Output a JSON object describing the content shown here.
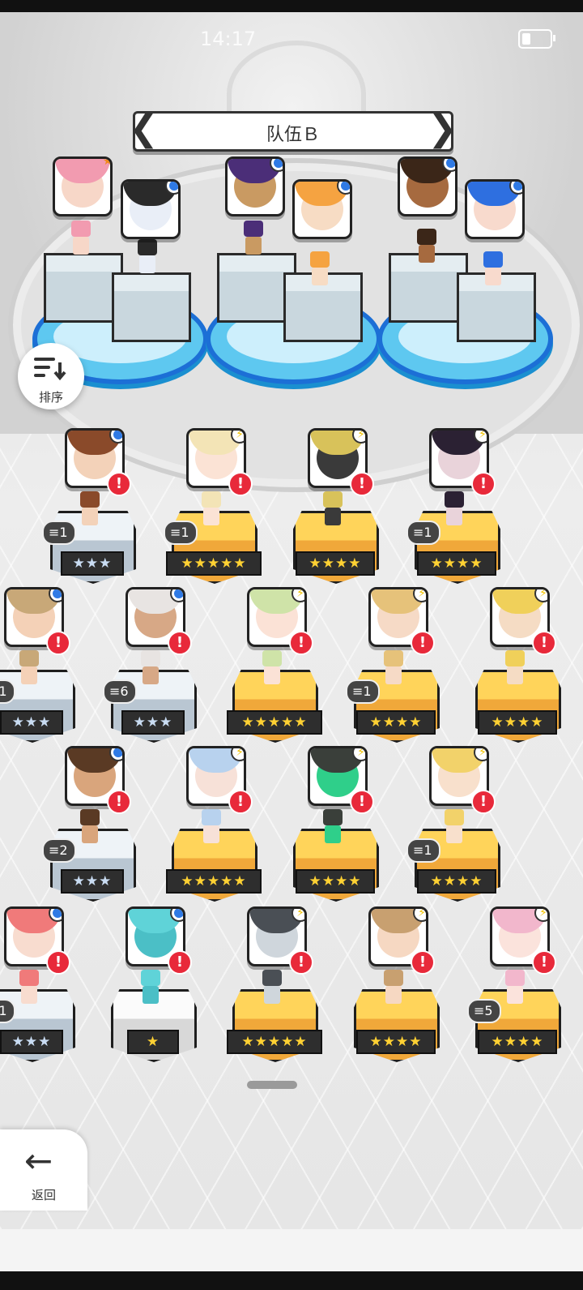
{
  "status": {
    "time": "14:17"
  },
  "team": {
    "title": "队伍Ｂ",
    "prev": "❮",
    "next": "❯"
  },
  "controls": {
    "sort_label": "排序",
    "back_label": "返回",
    "back_glyph": "←"
  },
  "team_members": [
    {
      "badge": "star",
      "badge_glyph": "★",
      "hair": "#f29bb0",
      "skin": "#f7d7c8"
    },
    {
      "badge": "blue",
      "badge_glyph": "",
      "hair": "#2a2a2a",
      "skin": "#e9eef7"
    },
    {
      "badge": "blue",
      "badge_glyph": "",
      "hair": "#4b2e78",
      "skin": "#c99a62"
    },
    {
      "badge": "blue",
      "badge_glyph": "",
      "hair": "#f5a341",
      "skin": "#f7dcc4"
    },
    {
      "badge": "blue",
      "badge_glyph": "",
      "hair": "#3b2618",
      "skin": "#a66a3f"
    },
    {
      "badge": "blue",
      "badge_glyph": "",
      "hair": "#2e6fe0",
      "skin": "#f8dacd"
    }
  ],
  "roster": [
    {
      "badge": "blue",
      "badge_glyph": "",
      "hair": "#8a4a2a",
      "skin": "#f3d2b9",
      "stars": "★★★",
      "tier": "silver",
      "level": "1"
    },
    {
      "badge": "bolt",
      "badge_glyph": "⚡",
      "hair": "#f3e4b6",
      "skin": "#fbe3d5",
      "stars": "★★★★★",
      "tier": "gold",
      "level": "1"
    },
    {
      "badge": "bolt",
      "badge_glyph": "⚡",
      "hair": "#d8c25a",
      "skin": "#3a3a3a",
      "stars": "★★★★",
      "tier": "gold",
      "level": ""
    },
    {
      "badge": "bolt",
      "badge_glyph": "⚡",
      "hair": "#2b2133",
      "skin": "#e9d3da",
      "stars": "★★★★",
      "tier": "gold",
      "level": "1"
    },
    {
      "badge": "blue",
      "badge_glyph": "",
      "hair": "#c8a878",
      "skin": "#f4d1b7",
      "stars": "★★★",
      "tier": "silver",
      "level": "1"
    },
    {
      "badge": "blue",
      "badge_glyph": "",
      "hair": "#e8e4e2",
      "skin": "#d7a886",
      "stars": "★★★",
      "tier": "silver",
      "level": "6"
    },
    {
      "badge": "bolt",
      "badge_glyph": "⚡",
      "hair": "#cfe3a8",
      "skin": "#fbe2d6",
      "stars": "★★★★★",
      "tier": "gold",
      "level": ""
    },
    {
      "badge": "bolt",
      "badge_glyph": "⚡",
      "hair": "#e6c27a",
      "skin": "#f6dac6",
      "stars": "★★★★",
      "tier": "gold",
      "level": "1"
    },
    {
      "badge": "bolt",
      "badge_glyph": "⚡",
      "hair": "#f0d05a",
      "skin": "#f5dcc4",
      "stars": "★★★★",
      "tier": "gold",
      "level": ""
    },
    {
      "badge": "blue",
      "badge_glyph": "",
      "hair": "#5a3a24",
      "skin": "#d9a57c",
      "stars": "★★★",
      "tier": "silver",
      "level": "2"
    },
    {
      "badge": "bolt",
      "badge_glyph": "⚡",
      "hair": "#b8d2ee",
      "skin": "#f7e1d8",
      "stars": "★★★★★",
      "tier": "gold",
      "level": ""
    },
    {
      "badge": "bolt",
      "badge_glyph": "⚡",
      "hair": "#3a3f3a",
      "skin": "#2fcf8a",
      "stars": "★★★★",
      "tier": "gold",
      "level": ""
    },
    {
      "badge": "bolt",
      "badge_glyph": "⚡",
      "hair": "#f2d26a",
      "skin": "#f8e0cc",
      "stars": "★★★★",
      "tier": "gold",
      "level": "1"
    },
    {
      "badge": "blue",
      "badge_glyph": "",
      "hair": "#f07a7a",
      "skin": "#f8dccf",
      "stars": "★★★",
      "tier": "silver",
      "level": "1"
    },
    {
      "badge": "blue",
      "badge_glyph": "",
      "hair": "#5fd3d8",
      "skin": "#4bbfc6",
      "stars": "★",
      "tier": "white",
      "level": ""
    },
    {
      "badge": "bolt",
      "badge_glyph": "⚡",
      "hair": "#4a4f55",
      "skin": "#cfd6dc",
      "stars": "★★★★★",
      "tier": "gold",
      "level": ""
    },
    {
      "badge": "bolt",
      "badge_glyph": "⚡",
      "hair": "#c8a070",
      "skin": "#f6d8c2",
      "stars": "★★★★",
      "tier": "gold",
      "level": ""
    },
    {
      "badge": "bolt",
      "badge_glyph": "⚡",
      "hair": "#f2b7cc",
      "skin": "#fbe3dc",
      "stars": "★★★★",
      "tier": "gold",
      "level": "5"
    }
  ],
  "alert_glyph": "!",
  "level_glyph": "≡"
}
